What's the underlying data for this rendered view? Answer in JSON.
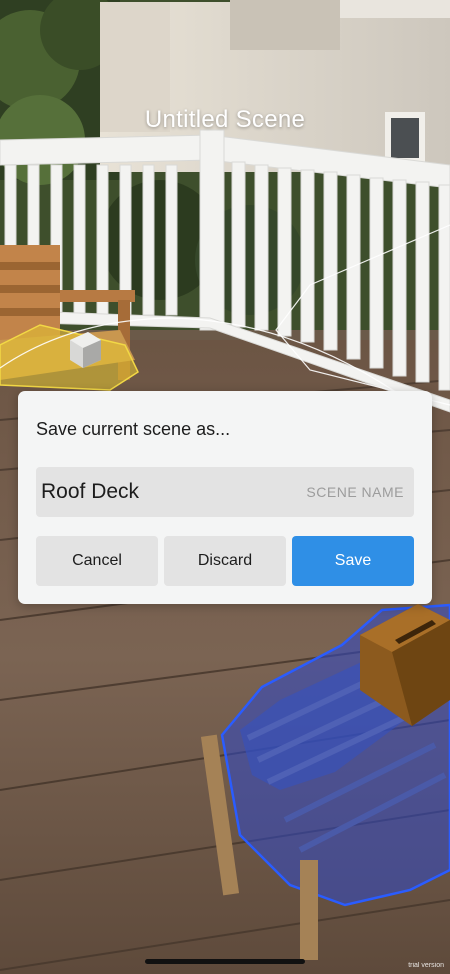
{
  "scene": {
    "title": "Untitled Scene"
  },
  "dialog": {
    "prompt": "Save current scene as...",
    "name_value": "Roof Deck",
    "name_hint": "SCENE NAME",
    "cancel_label": "Cancel",
    "discard_label": "Discard",
    "save_label": "Save"
  },
  "watermark": "trial version",
  "colors": {
    "accent": "#2f8fe6",
    "dialog_bg": "#f4f5f5",
    "button_bg": "#e3e3e3",
    "selection_outline": "#2a5cff"
  }
}
